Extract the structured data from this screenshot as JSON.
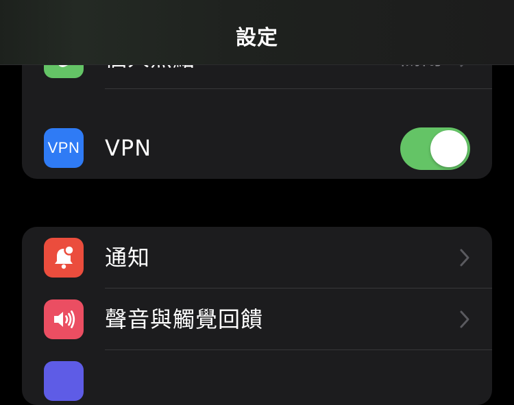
{
  "header": {
    "title": "設定"
  },
  "colors": {
    "hotspot": "#64c466",
    "vpn": "#2f7bf5",
    "notifications": "#eb4d3d",
    "sounds": "#eb4e62",
    "toggle_on": "#64c466"
  },
  "group_connectivity": {
    "hotspot": {
      "label": "個人熱點",
      "value": "關閉",
      "icon": "link-chain-icon"
    },
    "vpn": {
      "label": "VPN",
      "icon_text": "VPN",
      "toggle_on": true
    }
  },
  "group_alerts": {
    "notifications": {
      "label": "通知",
      "icon": "bell-badge-icon"
    },
    "sounds": {
      "label": "聲音與觸覺回饋",
      "icon": "speaker-icon"
    }
  }
}
